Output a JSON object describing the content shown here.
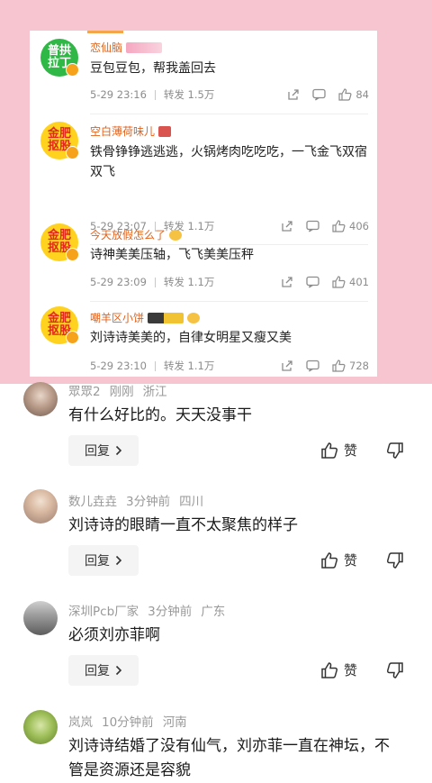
{
  "embedded_weibo": {
    "items": [
      {
        "avatar_text": "普拱拉丁",
        "name": "恋仙脑",
        "text": "豆包豆包，帮我盖回去",
        "time": "5-29 23:16",
        "repost": "转发 1.5万",
        "likes": "84"
      },
      {
        "avatar_text": "金肥抠股",
        "name": "空白薄荷味儿",
        "text": "铁骨铮铮逃逃逃，火锅烤肉吃吃吃，一飞金飞双宿双飞",
        "time": "5-29 23:07",
        "repost": "转发 1.1万",
        "likes": "406"
      },
      {
        "avatar_text": "金肥抠股",
        "name": "今天放假怎么了",
        "text": "诗神美美压轴，飞飞美美压秤",
        "time": "5-29 23:09",
        "repost": "转发 1.1万",
        "likes": "401"
      },
      {
        "avatar_text": "金肥抠股",
        "name": "嘲羊区小饼",
        "text": "刘诗诗美美的，自律女明星又瘦又美",
        "time": "5-29 23:10",
        "repost": "转发 1.1万",
        "likes": "728"
      }
    ]
  },
  "comments": [
    {
      "user": "眾眾2",
      "time": "刚刚",
      "location": "浙江",
      "text": "有什么好比的。天天没事干"
    },
    {
      "user": "数儿垚垚",
      "time": "3分钟前",
      "location": "四川",
      "text": "刘诗诗的眼睛一直不太聚焦的样子"
    },
    {
      "user": "深圳Pcb厂家",
      "time": "3分钟前",
      "location": "广东",
      "text": "必须刘亦菲啊"
    },
    {
      "user": "岚岚",
      "time": "10分钟前",
      "location": "河南",
      "text": "刘诗诗结婚了没有仙气，刘亦菲一直在神坛，不管是资源还是容貌"
    }
  ],
  "labels": {
    "reply": "回复",
    "like": "赞"
  },
  "colors": {
    "pink_background": "#f7c5cf",
    "weibo_name": "#e2621b",
    "meta_gray": "#999999"
  },
  "icons": [
    "share-icon",
    "comment-icon",
    "thumbs-up-icon",
    "thumbs-down-icon",
    "chevron-right-icon"
  ]
}
